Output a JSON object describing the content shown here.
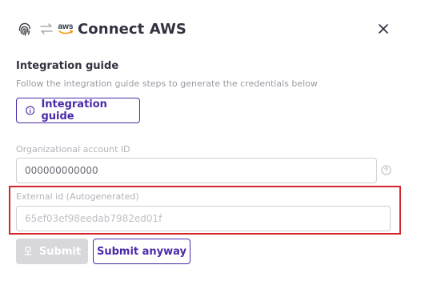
{
  "dialog": {
    "title": "Connect AWS",
    "aws_logo_text": "aws"
  },
  "guide": {
    "heading": "Integration guide",
    "description": "Follow the integration guide steps to generate the credentials below",
    "button_label": "Integration guide"
  },
  "fields": {
    "org_account": {
      "label": "Organizational account ID",
      "value": "000000000000"
    },
    "external_id": {
      "label": "External id (Autogenerated)",
      "value": "65ef03ef98eedab7982ed01f"
    }
  },
  "actions": {
    "submit_label": "Submit",
    "submit_anyway_label": "Submit anyway"
  },
  "icons": {
    "fingerprint": "fingerprint-icon",
    "swap": "swap-arrows-icon",
    "close": "close-icon",
    "info": "info-icon",
    "help": "help-circle-icon",
    "submit": "submit-icon"
  },
  "colors": {
    "accent": "#4b2aa8",
    "highlight": "#d4262c",
    "disabled_button": "#d8d8dc",
    "aws_orange": "#f79400"
  }
}
